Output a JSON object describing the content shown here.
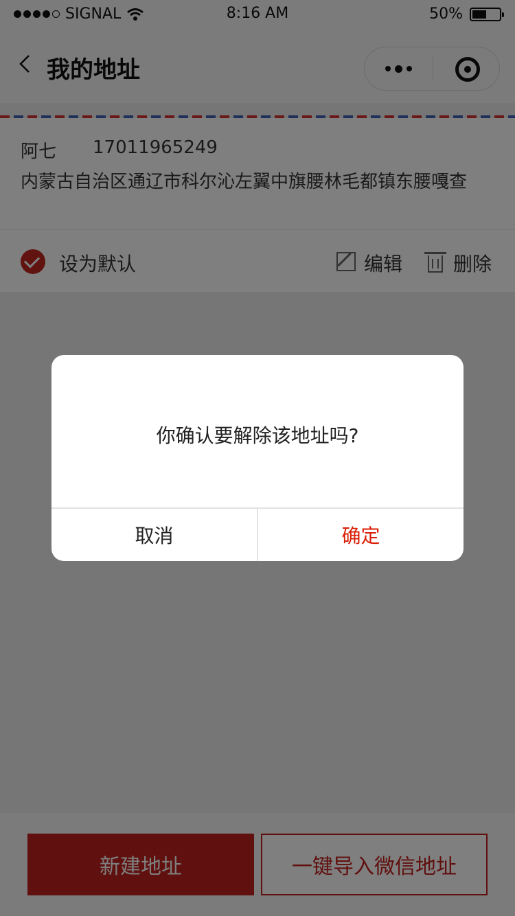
{
  "status_bar": {
    "carrier": "SIGNAL",
    "time": "8:16 AM",
    "battery": "50%",
    "battery_level": 0.5
  },
  "nav": {
    "title": "我的地址"
  },
  "address": {
    "name": "阿七",
    "phone": "17011965249",
    "detail": "内蒙古自治区通辽市科尔沁左翼中旗腰林毛都镇东腰嘎查"
  },
  "actions": {
    "default_label": "设为默认",
    "edit_label": "编辑",
    "delete_label": "删除"
  },
  "bottom": {
    "new_label": "新建地址",
    "import_label": "一键导入微信地址"
  },
  "dialog": {
    "message": "你确认要解除该地址吗?",
    "cancel_label": "取消",
    "confirm_label": "确定"
  },
  "colors": {
    "accent": "#c1201d",
    "confirm": "#d81e06"
  }
}
